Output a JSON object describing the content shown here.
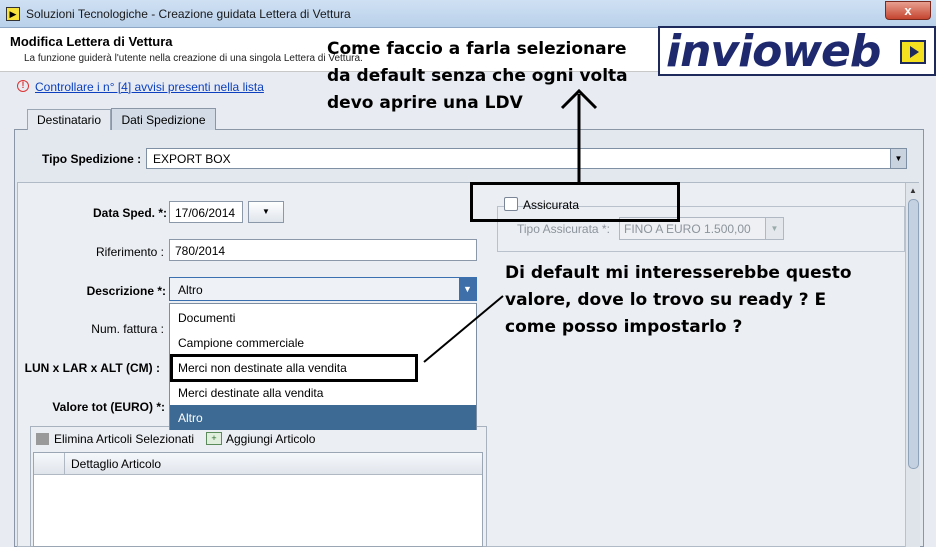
{
  "window": {
    "title": "Soluzioni Tecnologiche - Creazione guidata Lettera di Vettura",
    "close": "x"
  },
  "header": {
    "title": "Modifica Lettera di Vettura",
    "subtitle": "La funzione guiderà l'utente nella creazione di una singola Lettera di Vettura.",
    "logo": "invioweb"
  },
  "warning": {
    "link": "Controllare i n° [4] avvisi presenti nella lista"
  },
  "tabs": [
    {
      "label": "Destinatario"
    },
    {
      "label": "Dati Spedizione"
    }
  ],
  "tipo_spedizione": {
    "label": "Tipo Spedizione :",
    "value": "EXPORT BOX"
  },
  "form": {
    "data_sped": {
      "label": "Data Sped. *:",
      "value": "17/06/2014"
    },
    "riferimento": {
      "label": "Riferimento :",
      "value": "780/2014"
    },
    "descrizione": {
      "label": "Descrizione *:",
      "value": "Altro"
    },
    "num_fattura": {
      "label": "Num. fattura :"
    },
    "dimensioni": {
      "label": "LUN x LAR x ALT (CM) :"
    },
    "valore_tot": {
      "label": "Valore tot (EURO) *:"
    }
  },
  "dropdown_options": [
    "Documenti",
    "Campione commerciale",
    "Merci non destinate alla vendita",
    "Merci destinate alla vendita",
    "Altro"
  ],
  "articoli": {
    "delete": "Elimina Articoli Selezionati",
    "add": "Aggiungi Articolo",
    "column": "Dettaglio Articolo"
  },
  "assicurata": {
    "label": "Assicurata",
    "tipo_label": "Tipo Assicurata *:",
    "tipo_value": "FINO A EURO 1.500,00"
  },
  "annotations": {
    "note1": [
      "Come faccio a farla selezionare",
      "da default senza che ogni volta",
      "devo aprire una LDV"
    ],
    "note2": [
      "Di default mi interesserebbe questo",
      "valore, dove lo trovo su ready ? E",
      "come posso impostarlo ?"
    ]
  }
}
